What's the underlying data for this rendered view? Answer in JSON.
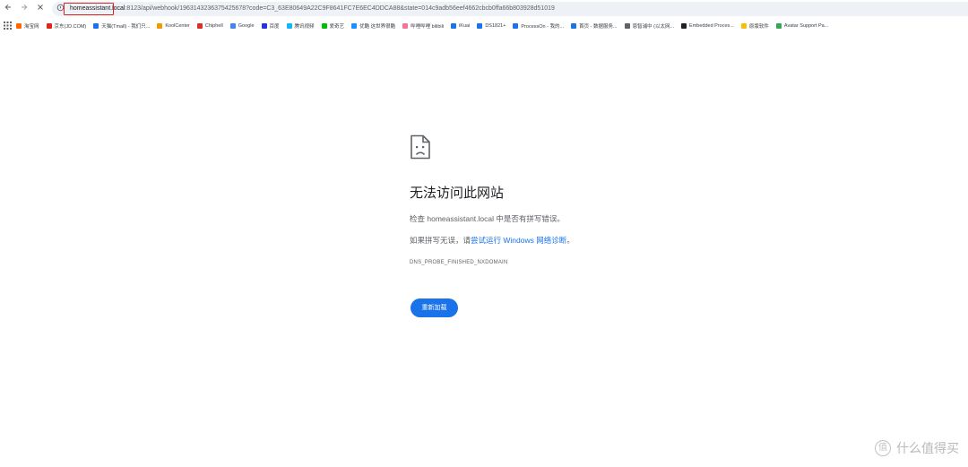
{
  "toolbar": {
    "back_icon": "arrow-left-icon",
    "forward_icon": "arrow-right-icon",
    "stop_icon": "close-icon",
    "url_host": "homeassistant.local",
    "url_rest": ":8123/api/webhook/1963143236375425678?code=C3_63E80649A22C9F8641FC7E6EC4DDCA88&state=014c9adb56eef4662cbcb0ffa66b803928d51019"
  },
  "bookmarks": {
    "items": [
      {
        "label": "淘宝网",
        "color": "#ff6a00"
      },
      {
        "label": "京东(JD.COM)",
        "color": "#e1251b"
      },
      {
        "label": "天猫(Tmall) - 我们只...",
        "color": "#1a73e8"
      },
      {
        "label": "KoolCenter",
        "color": "#f29900"
      },
      {
        "label": "Chiphell",
        "color": "#d93025"
      },
      {
        "label": "Google",
        "color": "#4285f4"
      },
      {
        "label": "百度",
        "color": "#2932e1"
      },
      {
        "label": "腾讯视频",
        "color": "#12b7f5"
      },
      {
        "label": "爱奇艺",
        "color": "#00be06"
      },
      {
        "label": "优酷 这世界很酷",
        "color": "#1f8fff"
      },
      {
        "label": "哔哩哔哩 bilibili",
        "color": "#fb7299"
      },
      {
        "label": "iKuai",
        "color": "#1a73e8"
      },
      {
        "label": "DS1821+",
        "color": "#1a73e8"
      },
      {
        "label": "ProcessOn - 我的...",
        "color": "#1a73e8"
      },
      {
        "label": "首页 - 数据服务...",
        "color": "#1a73e8"
      },
      {
        "label": "恩智浦中 (以太网...",
        "color": "#5f6368"
      },
      {
        "label": "Embedded Proces...",
        "color": "#202124"
      },
      {
        "label": "原版软件",
        "color": "#fbbc04"
      },
      {
        "label": "Avatar Support Pa...",
        "color": "#34a853"
      }
    ]
  },
  "error": {
    "icon": "sad-document-icon",
    "title": "无法访问此网站",
    "line1": "检查 homeassistant.local 中是否有拼写错误。",
    "line2_prefix": "如果拼写无误，请",
    "line2_link": "尝试运行 Windows 网络诊断",
    "line2_suffix": "。",
    "code": "DNS_PROBE_FINISHED_NXDOMAIN",
    "reload_label": "重新加载"
  },
  "watermark": {
    "badge": "值",
    "text": "什么值得买"
  }
}
